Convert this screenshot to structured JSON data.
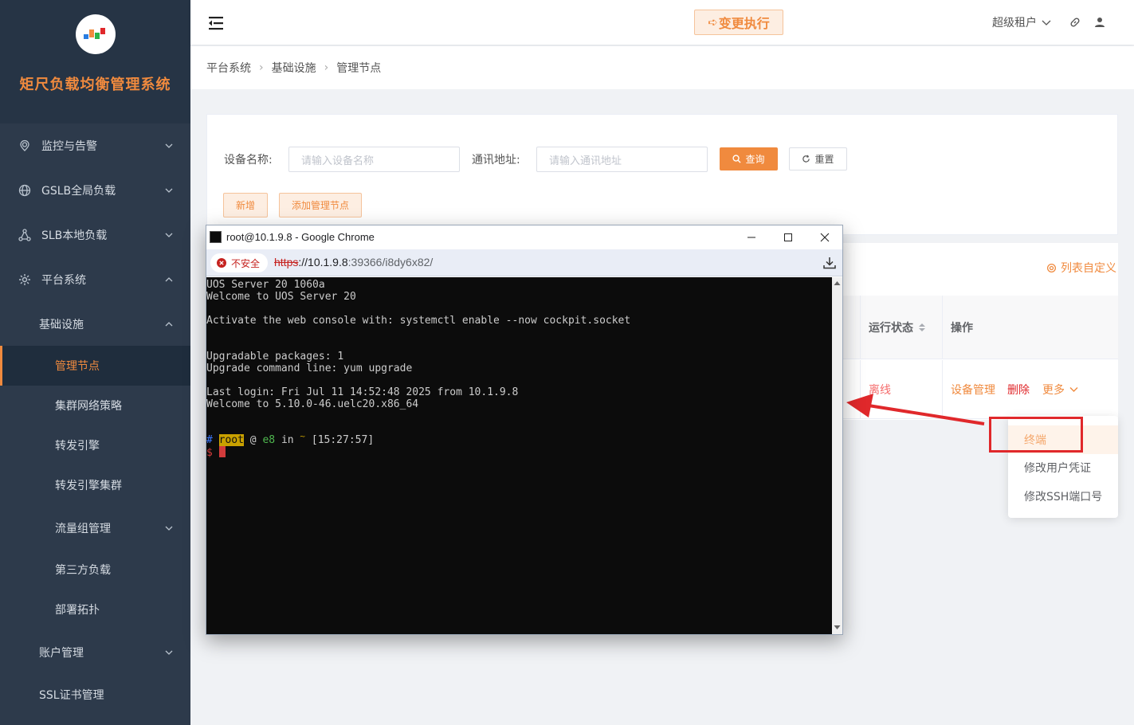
{
  "app": {
    "title": "矩尺负载均衡管理系统"
  },
  "sidebar": {
    "items": [
      {
        "label": "监控与告警",
        "icon": "location-icon"
      },
      {
        "label": "GSLB全局负载",
        "icon": "globe-icon"
      },
      {
        "label": "SLB本地负载",
        "icon": "network-icon"
      },
      {
        "label": "平台系统",
        "icon": "gear-icon"
      },
      {
        "label": "基础设施"
      },
      {
        "label": "管理节点"
      },
      {
        "label": "集群网络策略"
      },
      {
        "label": "转发引擎"
      },
      {
        "label": "转发引擎集群"
      },
      {
        "label": "流量组管理"
      },
      {
        "label": "第三方负载"
      },
      {
        "label": "部署拓扑"
      },
      {
        "label": "账户管理"
      },
      {
        "label": "SSL证书管理"
      }
    ]
  },
  "header": {
    "change_button": "变更执行",
    "tenant": "超级租户"
  },
  "breadcrumb": [
    "平台系统",
    "基础设施",
    "管理节点"
  ],
  "search": {
    "device_name_label": "设备名称:",
    "device_name_placeholder": "请输入设备名称",
    "address_label": "通讯地址:",
    "address_placeholder": "请输入通讯地址",
    "query_button": "查询",
    "reset_button": "重置",
    "add_button": "新增",
    "add_mgmt_button": "添加管理节点"
  },
  "table": {
    "customize": "列表自定义",
    "columns": {
      "status": "运行状态",
      "actions": "操作"
    },
    "row": {
      "status": "离线",
      "device_mgmt": "设备管理",
      "delete": "删除",
      "more": "更多"
    }
  },
  "dropdown": {
    "items": [
      "终端",
      "修改用户凭证",
      "修改SSH端口号"
    ]
  },
  "popup": {
    "title": "root@10.1.9.8 - Google Chrome",
    "insecure": "不安全",
    "url_scheme": "https",
    "url_host": "://10.1.9.8",
    "url_rest": ":39366/i8dy6x82/",
    "terminal": {
      "lines": [
        "UOS Server 20 1060a",
        "Welcome to UOS Server 20",
        "",
        "Activate the web console with: systemctl enable --now cockpit.socket",
        "",
        "",
        "Upgradable packages: 1",
        "Upgrade command line: yum upgrade",
        "",
        "Last login: Fri Jul 11 14:52:48 2025 from 10.1.9.8",
        "Welcome to 5.10.0-46.uelc20.x86_64"
      ],
      "prompt_hash": "#",
      "prompt_user": "root",
      "prompt_at": "@",
      "prompt_host": "e8",
      "prompt_in": "in",
      "prompt_dir": "~",
      "prompt_time": "[15:27:57]",
      "prompt_symbol": "$"
    }
  },
  "colors": {
    "accent": "#f08a3e",
    "sidebar_bg": "#2d3a4b",
    "alert_red": "#e0282b"
  }
}
